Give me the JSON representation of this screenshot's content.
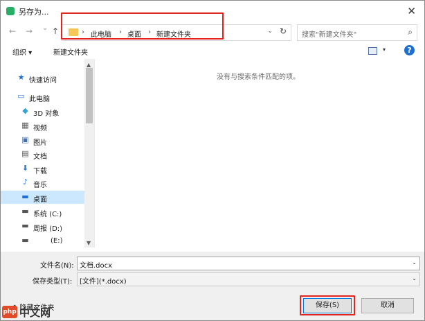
{
  "window": {
    "title": "另存为...",
    "close": "✕"
  },
  "nav": {
    "back": "←",
    "forward": "→",
    "history": "⌄",
    "up": "↑"
  },
  "address": {
    "crumbs": [
      "此电脑",
      "桌面",
      "新建文件夹"
    ],
    "separator": "›",
    "dropdown": "⌄",
    "refresh": "↻"
  },
  "search": {
    "placeholder": "搜索\"新建文件夹\"",
    "icon": "⌕"
  },
  "toolbar": {
    "organize": "组织 ▾",
    "new_folder": "新建文件夹",
    "view_caret": "▾",
    "help": "?"
  },
  "sidebar": {
    "items": [
      {
        "label": "快速访问",
        "icon": "★",
        "color": "#1f6fcf"
      },
      {
        "label": "此电脑",
        "icon": "▭",
        "color": "#3a7bd5"
      },
      {
        "label": "3D 对象",
        "icon": "◆",
        "color": "#37a0d9"
      },
      {
        "label": "视频",
        "icon": "▦",
        "color": "#555555"
      },
      {
        "label": "图片",
        "icon": "▣",
        "color": "#4a6fa5"
      },
      {
        "label": "文档",
        "icon": "▤",
        "color": "#555555"
      },
      {
        "label": "下载",
        "icon": "⬇",
        "color": "#2f7fd8"
      },
      {
        "label": "音乐",
        "icon": "♪",
        "color": "#2f7fd8"
      },
      {
        "label": "桌面",
        "icon": "▬",
        "color": "#1f6fcf",
        "selected": true
      },
      {
        "label": "系统 (C:)",
        "icon": "▬",
        "color": "#555555"
      },
      {
        "label": "周报 (D:)",
        "icon": "▬",
        "color": "#555555"
      },
      {
        "label": "(E:)",
        "icon": "▬",
        "color": "#555555"
      }
    ]
  },
  "content": {
    "empty_message": "没有与搜索条件匹配的项。"
  },
  "form": {
    "filename_label": "文件名(N):",
    "filename_value": "文档.docx",
    "filetype_label": "保存类型(T):",
    "filetype_value": "[文件](*.docx)",
    "caret": "⌄"
  },
  "footer": {
    "hide_folders": "^ 隐藏文件夹",
    "save": "保存(S)",
    "cancel": "取消"
  },
  "watermark": {
    "logo": "php",
    "text": "中文网"
  },
  "colors": {
    "highlight_box": "#e3231d",
    "selection": "#cce8ff",
    "accent": "#0078d7"
  }
}
